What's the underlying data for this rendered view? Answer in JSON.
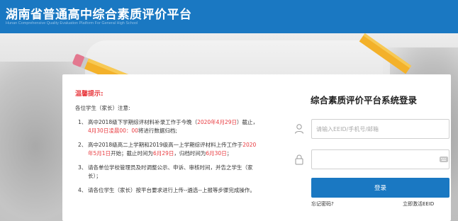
{
  "header": {
    "title": "湖南省普通高中综合素质评价平台",
    "subtitle": "Hunan Comprehensive Quality Evaluation Platform For General High School"
  },
  "notice": {
    "title": "温馨提示:",
    "greeting": "各位学生（家长）注意:",
    "items": [
      {
        "num": "1、",
        "p1": "高中2018级下学期综评材料补录工作于今晚（",
        "r1": "2020年4月29日",
        "p2": "）截止，",
        "r2": "4月30日凌晨00：00",
        "p3": "将进行数据归档;"
      },
      {
        "num": "2、",
        "p1": "高中2018级高二上学期和2019级高一上学期综评材料上传工作于",
        "r1": "2020年5月1日",
        "p2": "开始；截止时间为",
        "r2": "6月29日",
        "p3": "，归档时间为",
        "r3": "6月30日",
        "p4": "；"
      },
      {
        "num": "3、",
        "text": "请各单位学校管理员及时调整公示、申诉、审核时间，并告之学生（家长）；"
      },
      {
        "num": "4、",
        "text": "请各位学生（家长）按平台要求进行上传--遴选--上报等步骤完成操作。"
      }
    ]
  },
  "login": {
    "title": "综合素质评价平台系统登录",
    "username_placeholder": "请输入EEID/手机号/邮箱",
    "password_placeholder": "",
    "submit_label": "登录",
    "forgot_label": "忘记密码?",
    "activate_label": "立即激活EEID"
  },
  "icons": {
    "user": "user-icon",
    "lock": "lock-icon",
    "keyboard": "keyboard-icon"
  },
  "colors": {
    "brand": "#1a78c2",
    "alert": "#e8383d"
  }
}
